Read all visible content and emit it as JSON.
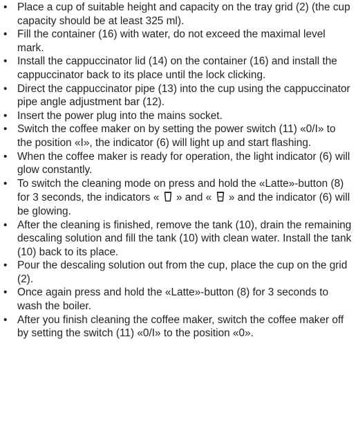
{
  "bullet": "•",
  "items": [
    {
      "text": "Place a cup of suitable height and capacity on the tray grid (2) (the cup capacity should be at least 325 ml)."
    },
    {
      "text": "Fill the container (16) with water, do not exceed the maximal level mark."
    },
    {
      "text": "Install the cappuccinator lid (14) on the container (16) and install the cappuccinator back to its place until the lock clicking."
    },
    {
      "text": "Direct the cappuccinator pipe (13) into the cup using the cappuccinator pipe angle adjustment bar (12)."
    },
    {
      "text": "Insert the power plug into the mains socket."
    },
    {
      "text": "Switch the coffee maker on by setting the power switch (11) «0/I» to the position «I», the indicator (6) will light up and start flashing."
    },
    {
      "text": "When the coffee maker is ready for operation, the light indicator (6) will glow constantly."
    },
    {
      "text_a": "To switch the cleaning mode on press and hold the «Latte»-button (8) for 3 seconds, the indicators «",
      "icon_1": "single-cup-icon",
      "text_b": "» and «",
      "icon_2": "double-cup-icon",
      "text_c": "» and the indicator (6) will be glowing."
    },
    {
      "text": "After the cleaning is finished, remove the tank (10), drain the remaining descaling solution and fill the tank (10) with clean water. Install the tank (10) back to its place."
    },
    {
      "text": "Pour the descaling solution out from the cup, place the cup on the grid (2)."
    },
    {
      "text": "Once again press and hold the «Latte»-button (8) for 3 seconds to wash the boiler."
    },
    {
      "text": "After you finish cleaning the coffee maker, switch the coffee maker off by setting the switch (11) «0/I» to the position «0»."
    }
  ]
}
